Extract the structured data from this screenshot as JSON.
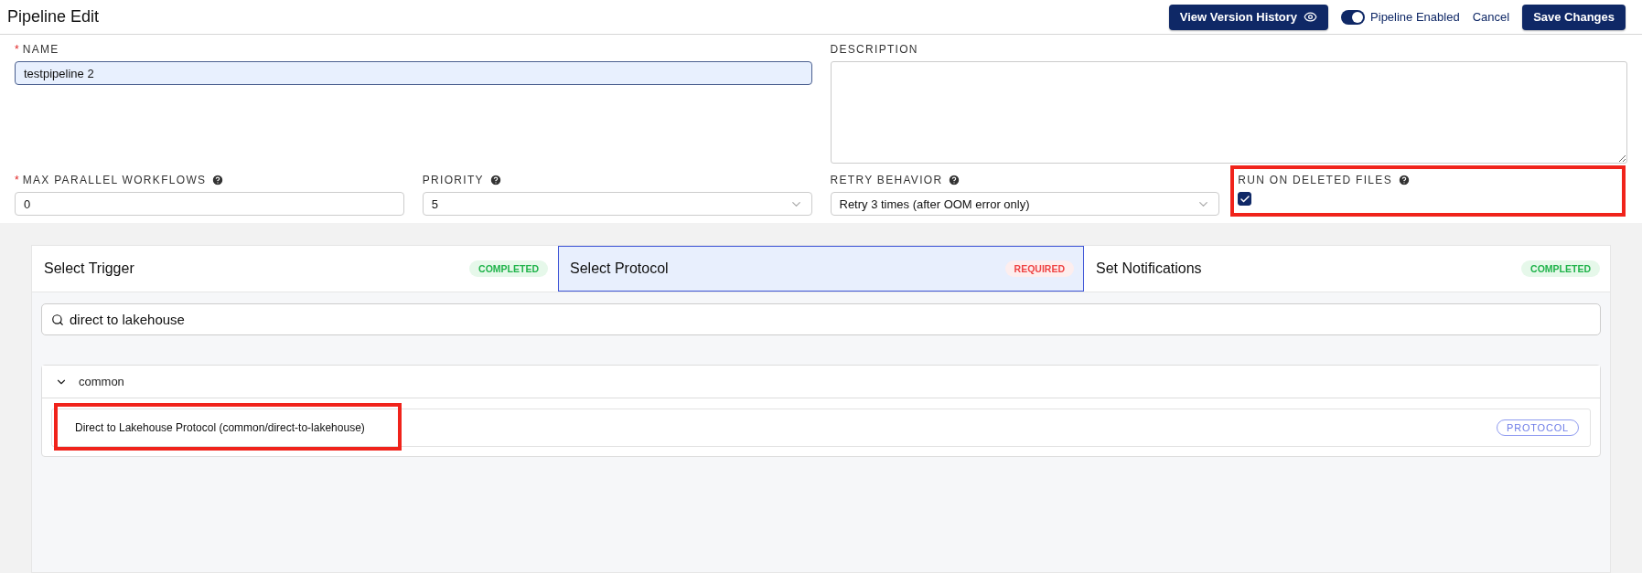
{
  "header": {
    "title": "Pipeline Edit",
    "history_button": "View Version History",
    "toggle": {
      "label": "Pipeline Enabled",
      "on": true
    },
    "cancel": "Cancel",
    "save": "Save Changes"
  },
  "name_field": {
    "label": "NAME",
    "required_mark": "*",
    "value": "testpipeline 2",
    "focused": true
  },
  "description_field": {
    "label": "DESCRIPTION"
  },
  "settings": [
    {
      "kind": "input",
      "label": "MAX PARALLEL WORKFLOWS",
      "required_mark": "*",
      "value": "0",
      "highlighted": false
    },
    {
      "kind": "select",
      "label": "PRIORITY",
      "value": "5",
      "highlighted": false
    },
    {
      "kind": "select",
      "label": "RETRY BEHAVIOR",
      "value": "Retry 3 times (after OOM error only)",
      "highlighted": false
    },
    {
      "kind": "checkbox",
      "label": "RUN ON DELETED FILES",
      "checked": true,
      "highlighted": true
    }
  ],
  "steps": [
    {
      "label": "Select Trigger",
      "status": "COMPLETED",
      "selected": false
    },
    {
      "label": "Select Protocol",
      "status": "REQUIRED",
      "selected": true
    },
    {
      "label": "Set Notifications",
      "status": "COMPLETED",
      "selected": false
    }
  ],
  "search": {
    "value": "direct to lakehouse"
  },
  "groups": [
    {
      "name": "common",
      "expanded": true,
      "items": [
        {
          "label": "Direct to Lakehouse Protocol (common/direct-to-lakehouse)",
          "tag": "PROTOCOL",
          "highlighted": true
        }
      ]
    }
  ]
}
